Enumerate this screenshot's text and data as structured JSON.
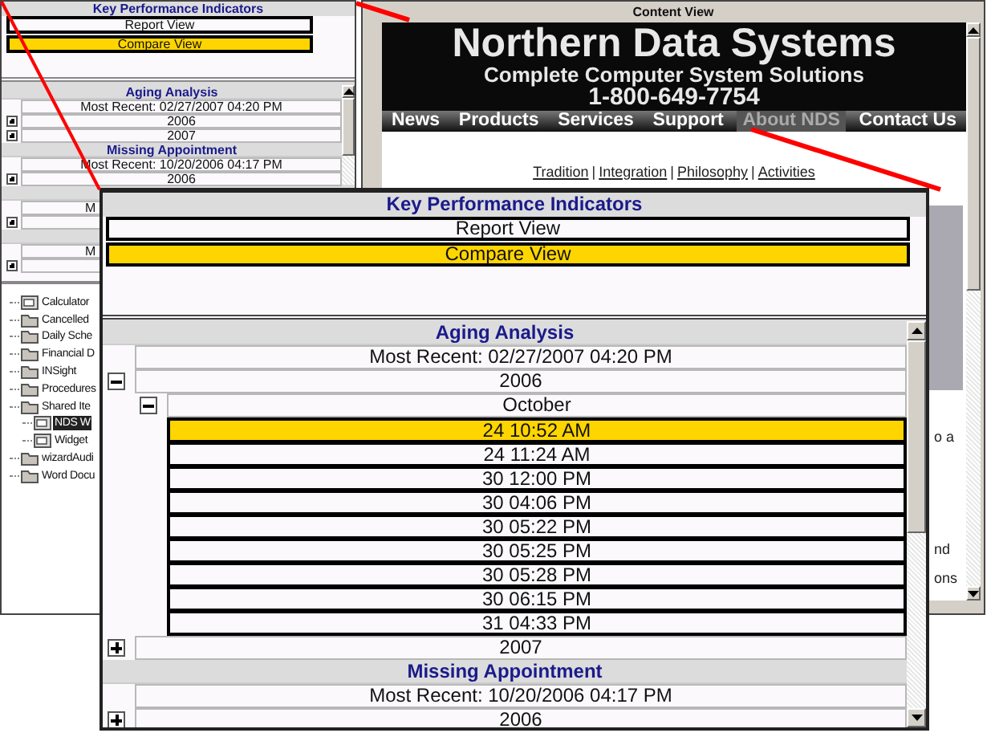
{
  "background": {
    "kpi_panel": {
      "title": "Key Performance Indicators",
      "views": [
        {
          "label": "Report View",
          "selected": false
        },
        {
          "label": "Compare View",
          "selected": true
        }
      ]
    },
    "report_list": {
      "groups": [
        {
          "title": "Aging Analysis",
          "rows": [
            {
              "kind": "summary",
              "text": "Most Recent: 02/27/2007 04:20 PM"
            },
            {
              "kind": "year",
              "text": "2006",
              "expanded": false
            },
            {
              "kind": "year",
              "text": "2007",
              "expanded": false
            }
          ]
        },
        {
          "title": "Missing Appointment",
          "rows": [
            {
              "kind": "summary",
              "text": "Most Recent: 10/20/2006 04:17 PM"
            },
            {
              "kind": "year",
              "text": "2006",
              "expanded": false
            }
          ]
        },
        {
          "rows": [
            {
              "kind": "summary",
              "text": "M",
              "clipped": true
            },
            {
              "kind": "year",
              "expanded": false
            }
          ]
        },
        {
          "rows": [
            {
              "kind": "summary",
              "text": "M",
              "clipped": true
            },
            {
              "kind": "year",
              "expanded": false
            }
          ]
        }
      ]
    },
    "tree": {
      "items": [
        {
          "label": "Calculator",
          "kind": "tool",
          "selected": false
        },
        {
          "label": "Cancelled",
          "kind": "folder",
          "selected": false
        },
        {
          "label": "Daily Sche",
          "kind": "folder",
          "selected": false
        },
        {
          "label": "Financial D",
          "kind": "folder",
          "selected": false
        },
        {
          "label": "INSight",
          "kind": "folder",
          "selected": false
        },
        {
          "label": "Procedures",
          "kind": "folder",
          "selected": false
        },
        {
          "label": "Shared Ite",
          "kind": "folder",
          "selected": false,
          "children": [
            {
              "label": "NDS W",
              "kind": "tool",
              "selected": true
            },
            {
              "label": "Widget",
              "kind": "tool",
              "selected": false
            }
          ]
        },
        {
          "label": "wizardAudi",
          "kind": "folder",
          "selected": false
        },
        {
          "label": "Word Docu",
          "kind": "folder",
          "selected": false
        }
      ]
    },
    "content_view": {
      "title": "Content View",
      "banner": {
        "company": "Northern Data Systems",
        "tagline": "Complete Computer System Solutions",
        "phone": "1-800-649-7754"
      },
      "nav": [
        {
          "label": "News",
          "selected": false
        },
        {
          "label": "Products",
          "selected": false
        },
        {
          "label": "Services",
          "selected": false
        },
        {
          "label": "Support",
          "selected": false
        },
        {
          "label": "About NDS",
          "selected": true
        },
        {
          "label": "Contact Us",
          "selected": false
        }
      ],
      "links": [
        {
          "kind": "link",
          "text": "Tradition"
        },
        {
          "kind": "separator",
          "text": "|"
        },
        {
          "kind": "link",
          "text": "Integration"
        },
        {
          "kind": "separator",
          "text": "|"
        },
        {
          "kind": "link",
          "text": "Philosophy"
        },
        {
          "kind": "separator",
          "text": "|"
        },
        {
          "kind": "link",
          "text": "Activities"
        }
      ],
      "text_fragments": [
        "o a",
        "nd",
        "ons"
      ]
    }
  },
  "zoom_window": {
    "kpi_panel": {
      "title": "Key Performance Indicators",
      "views": [
        {
          "label": "Report View",
          "selected": false
        },
        {
          "label": "Compare View",
          "selected": true
        }
      ]
    },
    "report_list": {
      "groups": [
        {
          "title": "Aging Analysis",
          "rows": [
            {
              "kind": "summary",
              "text": "Most Recent: 02/27/2007 04:20 PM"
            },
            {
              "kind": "year",
              "text": "2006",
              "expanded": true,
              "children": [
                {
                  "kind": "month",
                  "text": "October",
                  "expanded": true,
                  "children": [
                    {
                      "kind": "entry",
                      "text": "24 10:52 AM",
                      "selected": true
                    },
                    {
                      "kind": "entry",
                      "text": "24 11:24 AM",
                      "selected": false
                    },
                    {
                      "kind": "entry",
                      "text": "30 12:00 PM",
                      "selected": false
                    },
                    {
                      "kind": "entry",
                      "text": "30 04:06 PM",
                      "selected": false
                    },
                    {
                      "kind": "entry",
                      "text": "30 05:22 PM",
                      "selected": false
                    },
                    {
                      "kind": "entry",
                      "text": "30 05:25 PM",
                      "selected": false
                    },
                    {
                      "kind": "entry",
                      "text": "30 05:28 PM",
                      "selected": false
                    },
                    {
                      "kind": "entry",
                      "text": "30 06:15 PM",
                      "selected": false
                    },
                    {
                      "kind": "entry",
                      "text": "31 04:33 PM",
                      "selected": false
                    }
                  ]
                }
              ]
            },
            {
              "kind": "year",
              "text": "2007",
              "expanded": false
            }
          ]
        },
        {
          "title": "Missing Appointment",
          "rows": [
            {
              "kind": "summary",
              "text": "Most Recent: 10/20/2006 04:17 PM"
            },
            {
              "kind": "year",
              "text": "2006",
              "expanded": false
            }
          ]
        }
      ]
    }
  }
}
